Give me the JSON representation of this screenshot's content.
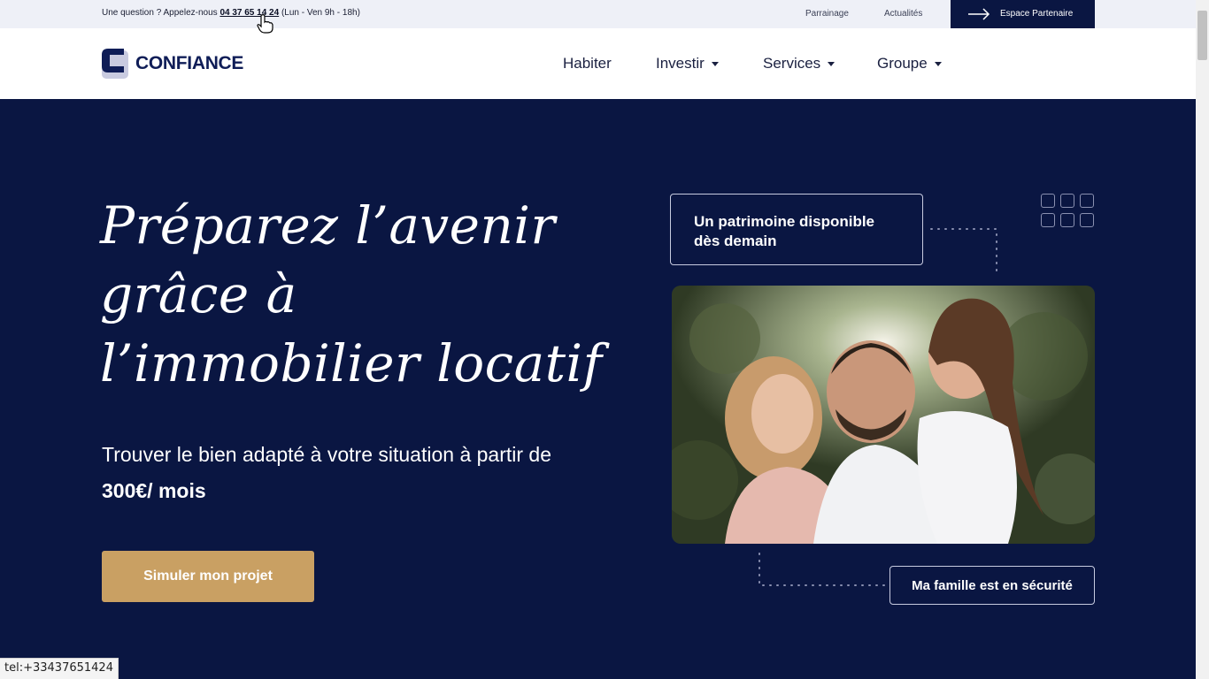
{
  "topbar": {
    "question": "Une question ? Appelez-nous ",
    "phone": "04 37 65 14 24",
    "hours": " (Lun - Ven 9h - 18h)",
    "links": [
      "Parrainage",
      "Actualités"
    ],
    "partner": "Espace Partenaire"
  },
  "header": {
    "logo": "CONFIANCE",
    "nav": [
      "Habiter",
      "Investir",
      "Services",
      "Groupe"
    ]
  },
  "hero": {
    "title": "Préparez l’avenir grâce à l’immobilier locatif",
    "subtitle_prefix": "Trouver le bien adapté à votre situation à partir de ",
    "subtitle_bold": "300€/ mois",
    "cta": "Simuler mon projet",
    "card_top": "Un patrimoine disponible dès demain",
    "card_bottom": "Ma famille est en sécurité"
  },
  "colors": {
    "navy": "#0a1642",
    "gold": "#c9a063",
    "topbar": "#eef0f7"
  },
  "status_bar": "tel:+33437651424"
}
